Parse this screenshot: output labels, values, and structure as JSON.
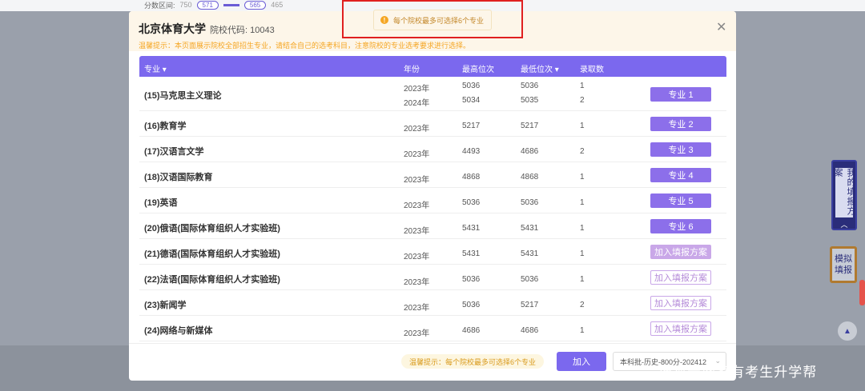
{
  "background": {
    "range_label": "分数区间:",
    "range_values": [
      "750",
      "571",
      "565",
      "465"
    ]
  },
  "modal": {
    "school_name": "北京体育大学",
    "school_code": "院校代码: 10043",
    "notice": "温馨提示：本页面展示院校全部招生专业，请结合自己的选考科目，注意院校的专业选考要求进行选择。",
    "headers": {
      "major": "专业",
      "year": "年份",
      "max_rank": "最高位次",
      "min_rank": "最低位次",
      "count": "录取数"
    },
    "rows": [
      {
        "name": "(15)马克思主义理论",
        "years": [
          "2023年",
          "2024年"
        ],
        "max": [
          "5036",
          "5034"
        ],
        "min": [
          "5036",
          "5035"
        ],
        "count": [
          "1",
          "2"
        ],
        "action": "专业 1",
        "state": "selected"
      },
      {
        "name": "(16)教育学",
        "years": [
          "2023年"
        ],
        "max": [
          "5217"
        ],
        "min": [
          "5217"
        ],
        "count": [
          "1"
        ],
        "action": "专业 2",
        "state": "selected"
      },
      {
        "name": "(17)汉语言文学",
        "years": [
          "2023年"
        ],
        "max": [
          "4493"
        ],
        "min": [
          "4686"
        ],
        "count": [
          "2"
        ],
        "action": "专业 3",
        "state": "selected"
      },
      {
        "name": "(18)汉语国际教育",
        "years": [
          "2023年"
        ],
        "max": [
          "4868"
        ],
        "min": [
          "4868"
        ],
        "count": [
          "1"
        ],
        "action": "专业 4",
        "state": "selected"
      },
      {
        "name": "(19)英语",
        "years": [
          "2023年"
        ],
        "max": [
          "5036"
        ],
        "min": [
          "5036"
        ],
        "count": [
          "1"
        ],
        "action": "专业 5",
        "state": "selected"
      },
      {
        "name": "(20)俄语(国际体育组织人才实验班)",
        "years": [
          "2023年"
        ],
        "max": [
          "5431"
        ],
        "min": [
          "5431"
        ],
        "count": [
          "1"
        ],
        "action": "专业 6",
        "state": "selected"
      },
      {
        "name": "(21)德语(国际体育组织人才实验班)",
        "years": [
          "2023年"
        ],
        "max": [
          "5431"
        ],
        "min": [
          "5431"
        ],
        "count": [
          "1"
        ],
        "action": "加入填报方案",
        "state": "add-filled"
      },
      {
        "name": "(22)法语(国际体育组织人才实验班)",
        "years": [
          "2023年"
        ],
        "max": [
          "5036"
        ],
        "min": [
          "5036"
        ],
        "count": [
          "1"
        ],
        "action": "加入填报方案",
        "state": "add"
      },
      {
        "name": "(23)新闻学",
        "years": [
          "2023年"
        ],
        "max": [
          "5036"
        ],
        "min": [
          "5217"
        ],
        "count": [
          "2"
        ],
        "action": "加入填报方案",
        "state": "add"
      },
      {
        "name": "(24)网络与新媒体",
        "years": [
          "2023年"
        ],
        "max": [
          "4686"
        ],
        "min": [
          "4686"
        ],
        "count": [
          "1"
        ],
        "action": "加入填报方案",
        "state": "add"
      }
    ],
    "footer": {
      "tip": "温馨提示：每个院校最多可选择6个专业",
      "join": "加入",
      "batch": "本科批-历史-800分-202412"
    }
  },
  "toast": {
    "text": "每个院校最多可选择6个专业"
  },
  "side": {
    "plan": "我的填报方案",
    "simulate": "模拟填报"
  },
  "watermark": "搜狐号@家有考生升学帮",
  "colors": {
    "accent": "#7b68ee",
    "warning": "#f5a623",
    "highlight": "#e02020"
  }
}
